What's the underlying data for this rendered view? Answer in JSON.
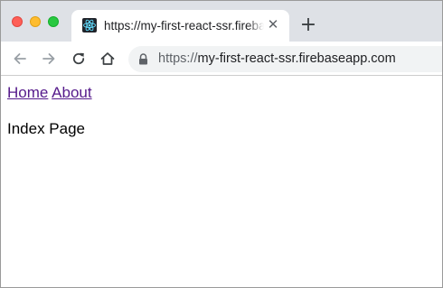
{
  "browser": {
    "tab": {
      "title": "https://my-first-react-ssr.firebaseapp.com",
      "favicon": "react-logo-icon",
      "close_glyph": "✕"
    },
    "new_tab_glyph": "+",
    "toolbar": {
      "back_icon": "arrow-left-icon",
      "forward_icon": "arrow-right-icon",
      "reload_icon": "reload-icon",
      "home_icon": "home-icon"
    },
    "address": {
      "scheme": "https://",
      "host": "my-first-react-ssr.firebaseapp.com",
      "lock_icon": "lock-icon"
    }
  },
  "page": {
    "nav": {
      "home_label": "Home",
      "about_label": "About"
    },
    "heading": "Index Page"
  },
  "colors": {
    "tabstrip_bg": "#dee1e6",
    "visited_link": "#551a8b",
    "omnibox_bg": "#f1f3f4"
  }
}
